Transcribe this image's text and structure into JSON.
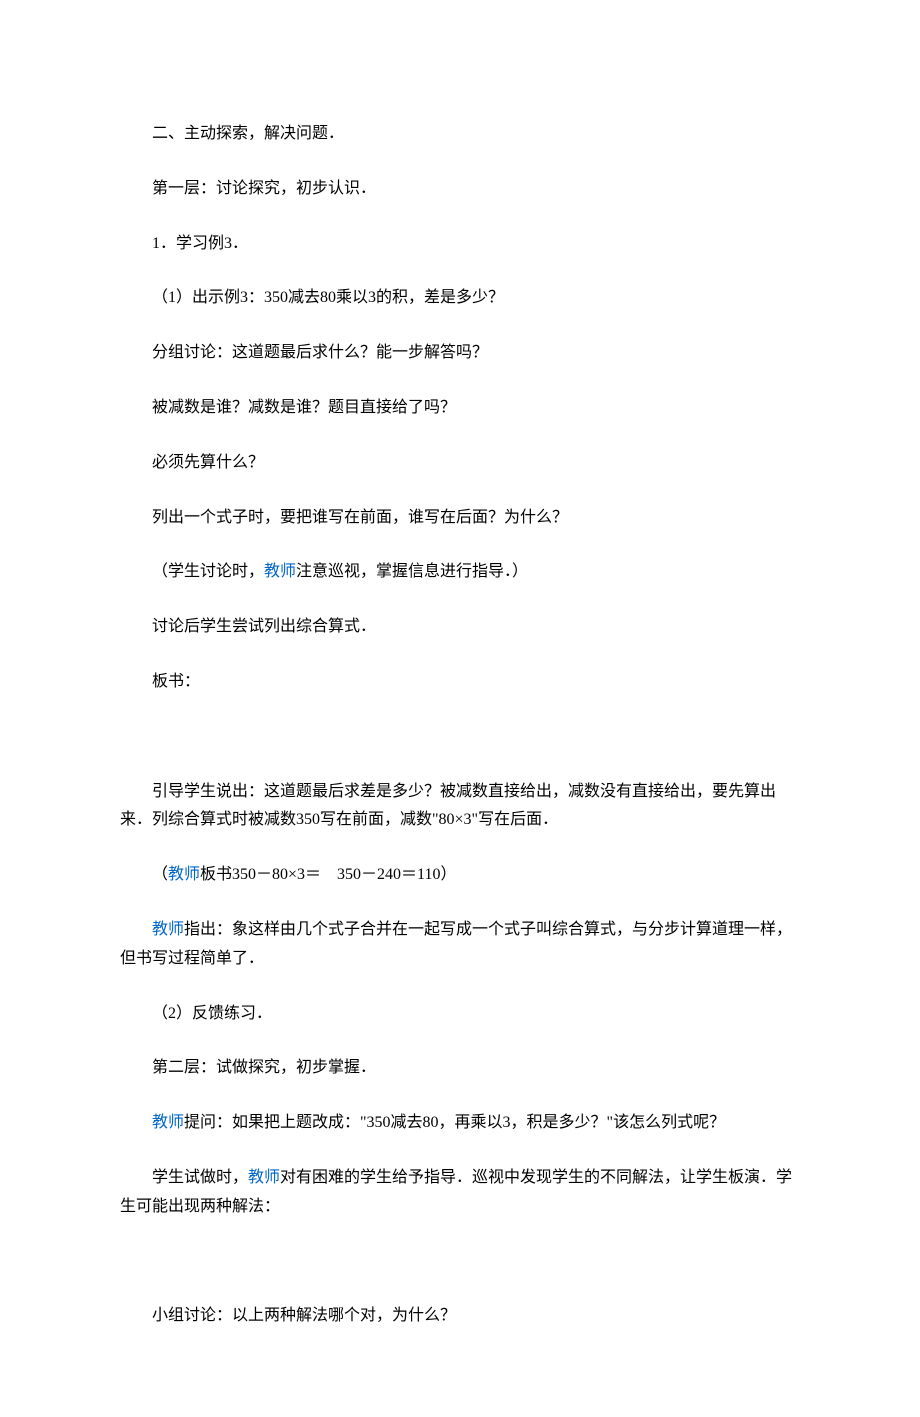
{
  "paragraphs": [
    {
      "text": "二、主动探索，解决问题．"
    },
    {
      "text": "第一层：讨论探究，初步认识．"
    },
    {
      "text": "1．学习例3．"
    },
    {
      "text": "（1）出示例3：350减去80乘以3的积，差是多少？"
    },
    {
      "text": "分组讨论：这道题最后求什么？能一步解答吗？"
    },
    {
      "text": "被减数是谁？减数是谁？题目直接给了吗？"
    },
    {
      "text": "必须先算什么？"
    },
    {
      "text": "列出一个式子时，要把谁写在前面，谁写在后面？为什么？"
    },
    {
      "parts": [
        {
          "t": "（学生讨论时，"
        },
        {
          "t": "教师",
          "link": true
        },
        {
          "t": "注意巡视，掌握信息进行指导．）"
        }
      ]
    },
    {
      "text": "讨论后学生尝试列出综合算式．"
    },
    {
      "text": "板书："
    },
    {
      "text": " ",
      "spacer": true
    },
    {
      "text": "引导学生说出：这道题最后求差是多少？被减数直接给出，减数没有直接给出，要先算出来．列综合算式时被减数350写在前面，减数\"80×3\"写在后面．"
    },
    {
      "parts": [
        {
          "t": "（"
        },
        {
          "t": "教师",
          "link": true
        },
        {
          "t": "板书350－80×3＝　350－240＝110）"
        }
      ]
    },
    {
      "parts": [
        {
          "t": "教师",
          "link": true
        },
        {
          "t": "指出：象这样由几个式子合并在一起写成一个式子叫综合算式，与分步计算道理一样，但书写过程简单了．"
        }
      ]
    },
    {
      "text": "（2）反馈练习．"
    },
    {
      "text": "第二层：试做探究，初步掌握．"
    },
    {
      "parts": [
        {
          "t": "教师",
          "link": true
        },
        {
          "t": "提问：如果把上题改成：\"350减去80，再乘以3，积是多少？\"该怎么列式呢？"
        }
      ]
    },
    {
      "parts": [
        {
          "t": "学生试做时，"
        },
        {
          "t": "教师",
          "link": true
        },
        {
          "t": "对有困难的学生给予指导．巡视中发现学生的不同解法，让学生板演．学生可能出现两种解法："
        }
      ]
    },
    {
      "text": " ",
      "spacer": true
    },
    {
      "text": "小组讨论：以上两种解法哪个对，为什么？"
    }
  ]
}
